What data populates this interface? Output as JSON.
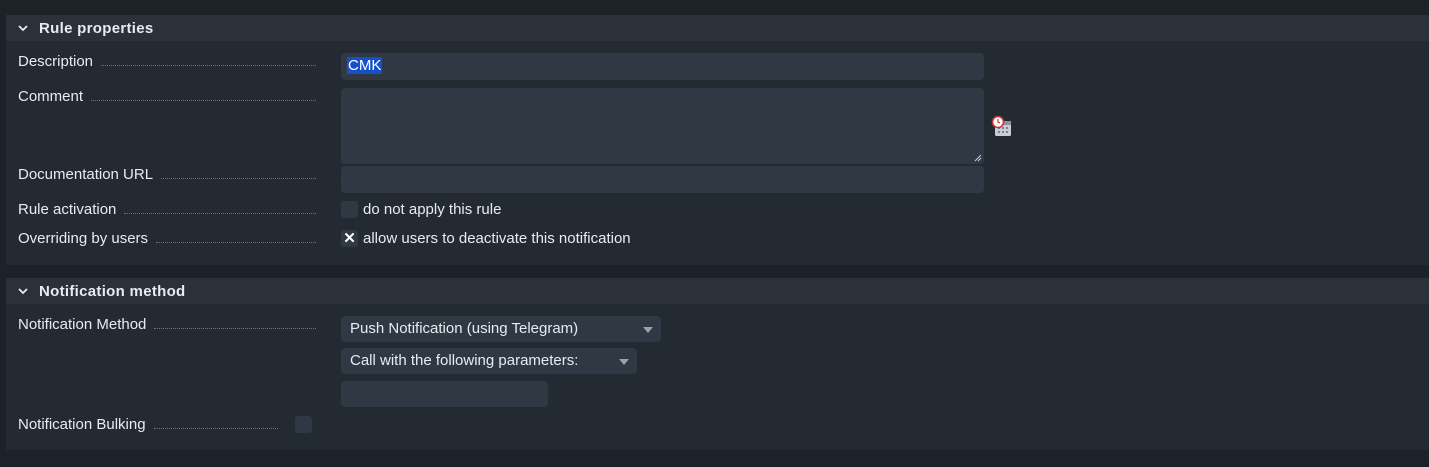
{
  "rule_properties": {
    "title": "Rule properties",
    "description_label": "Description",
    "description_value": "CMK",
    "comment_label": "Comment",
    "comment_value": "",
    "documentation_url_label": "Documentation URL",
    "documentation_url_value": "",
    "rule_activation_label": "Rule activation",
    "rule_activation_checkbox_label": "do not apply this rule",
    "rule_activation_checked": false,
    "overriding_label": "Overriding by users",
    "overriding_checkbox_label": "allow users to deactivate this notification",
    "overriding_checked": true,
    "overriding_check_glyph": "✕",
    "comment_icon": "timestamp-calendar-icon"
  },
  "notification_method": {
    "title": "Notification method",
    "method_label": "Notification Method",
    "method_value": "Push Notification (using Telegram)",
    "call_value": "Call with the following parameters:",
    "parameter_value": "",
    "bulking_label": "Notification Bulking",
    "bulking_checked": false
  },
  "colors": {
    "background": "#1d2229",
    "section": "#232a32",
    "input": "#2f3843",
    "selection": "#1650c8"
  }
}
